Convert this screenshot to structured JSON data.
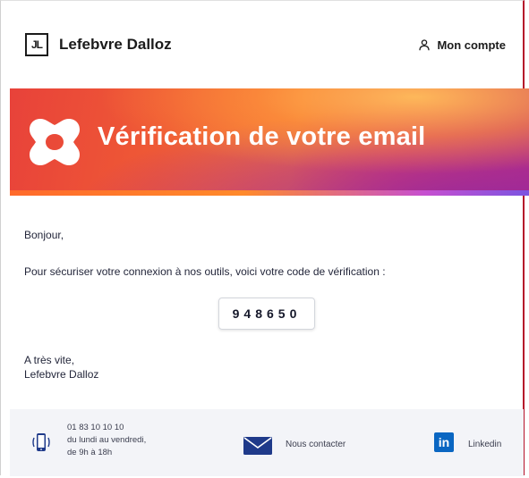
{
  "header": {
    "logo_text": "JL",
    "brand_name": "Lefebvre Dalloz",
    "account_label": "Mon compte",
    "account_icon": "user-icon"
  },
  "banner": {
    "title": "Vérification de votre email",
    "icon": "brand-x-icon"
  },
  "content": {
    "greeting": "Bonjour,",
    "message": "Pour sécuriser votre connexion à nos outils, voici votre code de vérification :",
    "code": "948650",
    "signoff_line1": "A très vite,",
    "signoff_line2": "Lefebvre Dalloz"
  },
  "footer": {
    "phone_icon": "phone-icon",
    "phone_number": "01 83 10 10 10",
    "hours_line1": "du lundi au vendredi,",
    "hours_line2": "de 9h à 18h",
    "contact_icon": "envelope-icon",
    "contact_label": "Nous contacter",
    "linkedin_icon": "linkedin-icon",
    "linkedin_logo_text": "in",
    "linkedin_label": "Linkedin"
  },
  "colors": {
    "brand_dark": "#1b1b1b",
    "banner_orange": "#f47a36",
    "banner_red": "#e8423a",
    "banner_purple": "#b7307f",
    "mail_blue": "#1f3a8a",
    "linkedin_blue": "#0a66c2",
    "footer_bg": "#f3f4f8"
  }
}
